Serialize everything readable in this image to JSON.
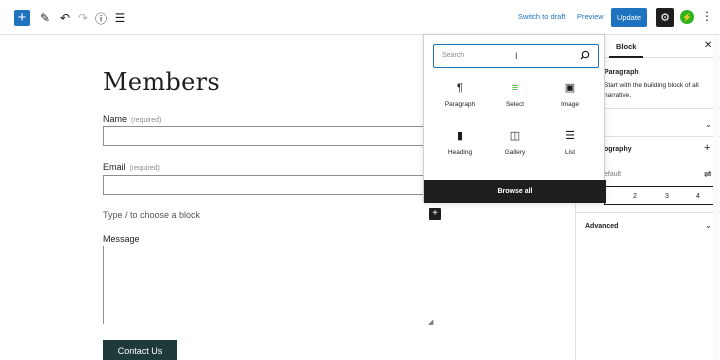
{
  "toolbar": {
    "add_icon": "plus-icon",
    "tools_icon": "pencil-icon",
    "undo_icon": "undo-icon",
    "redo_icon": "redo-icon",
    "info_icon": "info-icon",
    "list_view_icon": "list-view-icon",
    "switch_to_draft": "Switch to draft",
    "preview": "Preview",
    "update": "Update",
    "settings_icon": "gear-icon",
    "jetpack_icon": "jetpack-icon",
    "more_icon": "more-vertical-icon"
  },
  "editor": {
    "title": "Members",
    "fields": [
      {
        "label": "Name",
        "required": "(required)"
      },
      {
        "label": "Email",
        "required": "(required)"
      }
    ],
    "block_hint": "Type / to choose a block",
    "message_label": "Message",
    "submit_label": "Contact Us"
  },
  "sidebar": {
    "tab_block": "Block",
    "close_icon": "close-icon",
    "paragraph_title": "Paragraph",
    "paragraph_desc": "Start with the building block of all narrative.",
    "typography_title": "ography",
    "default_text": "efault",
    "columns": [
      "2",
      "3",
      "4"
    ],
    "advanced_title": "Advanced"
  },
  "inserter": {
    "search_placeholder": "Search",
    "search_icon": "search-icon",
    "blocks": [
      {
        "label": "Paragraph",
        "icon": "paragraph-icon",
        "glyph": "¶"
      },
      {
        "label": "Select",
        "icon": "select-icon",
        "glyph": "≡"
      },
      {
        "label": "Image",
        "icon": "image-icon",
        "glyph": "▣"
      },
      {
        "label": "Heading",
        "icon": "heading-icon",
        "glyph": "▮"
      },
      {
        "label": "Gallery",
        "icon": "gallery-icon",
        "glyph": "◫"
      },
      {
        "label": "List",
        "icon": "list-icon",
        "glyph": "☰"
      }
    ],
    "browse_all": "Browse all"
  },
  "colors": {
    "accent": "#1e73be",
    "dark": "#1e1e1e",
    "green": "#2fb41f",
    "submit": "#1e3a3a"
  }
}
